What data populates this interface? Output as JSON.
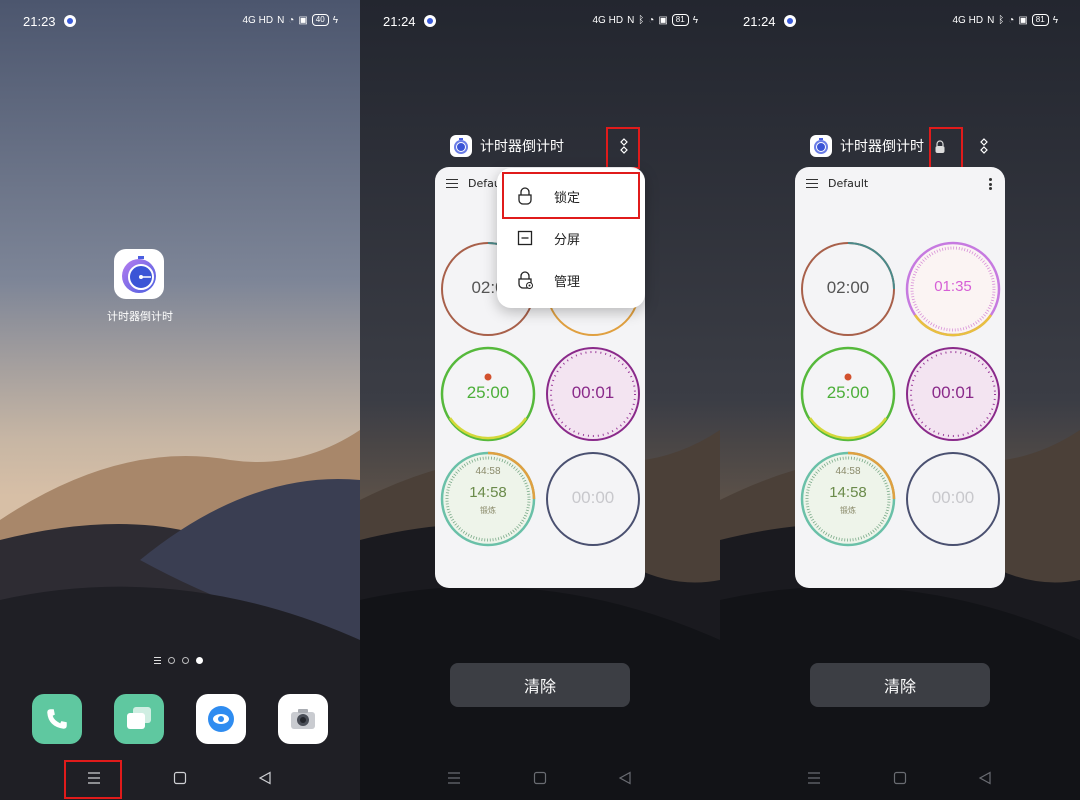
{
  "panel1": {
    "status": {
      "time": "21:23",
      "network": "4G HD",
      "battery": "40"
    },
    "home_app": {
      "label": "计时器倒计时"
    },
    "dock": [
      "phone-icon",
      "messages-icon",
      "browser-icon",
      "camera-icon"
    ]
  },
  "panel2": {
    "status": {
      "time": "21:24",
      "network": "4G HD",
      "battery": "81"
    },
    "app_title": "计时器倒计时",
    "card_title": "Defau",
    "menu": [
      {
        "label": "锁定",
        "icon": "lock-icon"
      },
      {
        "label": "分屏",
        "icon": "split-screen-icon"
      },
      {
        "label": "管理",
        "icon": "manage-lock-icon"
      }
    ],
    "timers": {
      "t1": "02:0",
      "t3": "25:00",
      "t4": "00:01",
      "t5_sub": "44:58",
      "t5": "14:58",
      "t5_label": "锻炼",
      "t6": "00:00"
    },
    "clear_label": "清除"
  },
  "panel3": {
    "status": {
      "time": "21:24",
      "network": "4G HD",
      "battery": "81"
    },
    "app_title": "计时器倒计时",
    "card_title": "Default",
    "timers": {
      "t1": "02:00",
      "t2": "01:35",
      "t3": "25:00",
      "t4": "00:01",
      "t5_sub": "44:58",
      "t5": "14:58",
      "t5_label": "锻炼",
      "t6": "00:00"
    },
    "clear_label": "清除"
  },
  "colors": {
    "highlight": "#e01b1b",
    "green": "#4caf3a",
    "purple": "#8a2a8a",
    "pink": "#d65fd6"
  }
}
